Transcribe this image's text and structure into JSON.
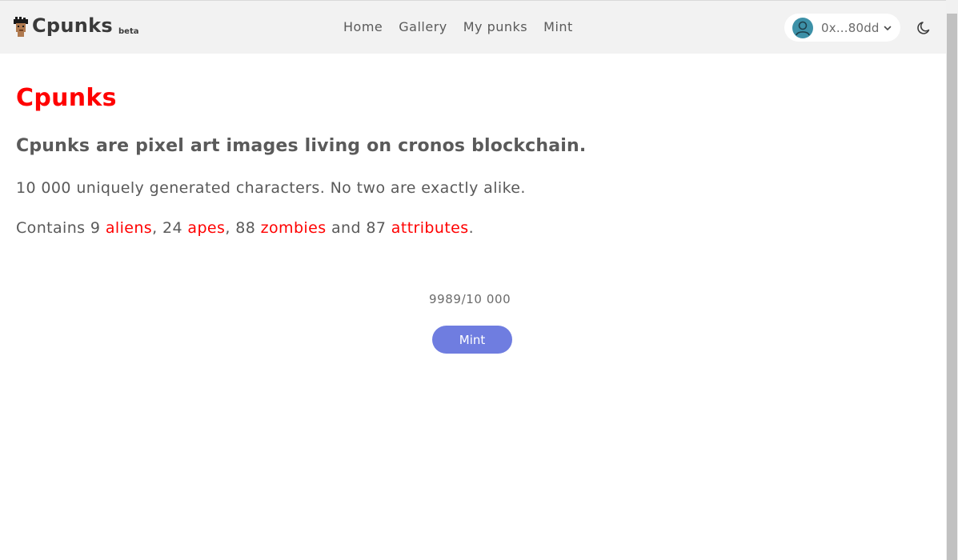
{
  "header": {
    "brand": {
      "name": "Cpunks",
      "tag": "beta",
      "logo_icon": "punk-avatar-icon"
    },
    "nav": [
      {
        "label": "Home"
      },
      {
        "label": "Gallery"
      },
      {
        "label": "My punks"
      },
      {
        "label": "Mint"
      }
    ],
    "wallet": {
      "address": "0x...80dd",
      "avatar_icon": "user-avatar-icon",
      "dropdown_icon": "chevron-down-icon"
    },
    "theme_toggle_icon": "moon-icon"
  },
  "main": {
    "title": "Cpunks",
    "subtitle": "Cpunks are pixel art images living on cronos blockchain.",
    "description": "10 000 uniquely generated characters. No two are exactly alike.",
    "contains": {
      "prefix": "Contains",
      "aliens_count": "9",
      "aliens_label": "aliens",
      "apes_count": "24",
      "apes_label": "apes",
      "zombies_count": "88",
      "zombies_label": "zombies",
      "and_text": "and",
      "attributes_count": "87",
      "attributes_label": "attributes"
    },
    "mint_counter": "9989/10 000",
    "mint_button": "Mint"
  },
  "colors": {
    "accent_red": "#ff0000",
    "mint_button": "#6f7de0",
    "navbar_bg": "#f2f2f2",
    "avatar_bg": "#3d91a8"
  }
}
